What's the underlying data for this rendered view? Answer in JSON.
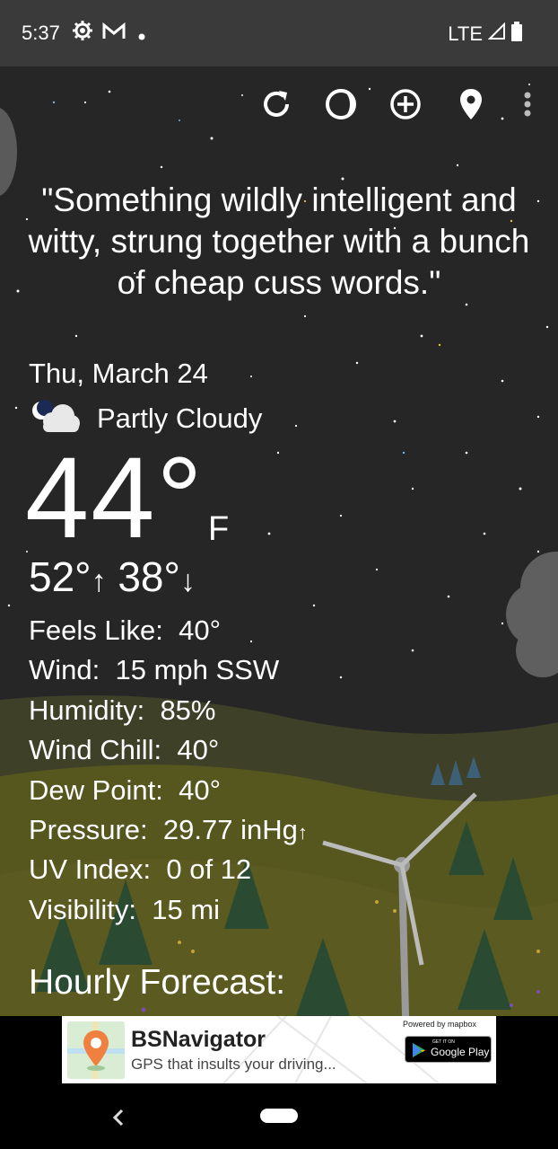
{
  "status": {
    "time": "5:37",
    "network": "LTE",
    "icons": [
      "settings-gear-icon",
      "gmail-icon",
      "notification-dot-icon",
      "signal-icon",
      "battery-icon"
    ]
  },
  "toolbar": {
    "icons": [
      "refresh-icon",
      "theme-icon",
      "add-location-icon",
      "location-pin-icon",
      "more-vert-icon"
    ]
  },
  "quote": "\"Something wildly intelligent and witty, strung together with a bunch of cheap cuss words.\"",
  "weather": {
    "date": "Thu, March 24",
    "condition": "Partly Cloudy",
    "condition_icon": "partly-cloudy-night-icon",
    "temperature": "44°",
    "unit": "F",
    "high": "52°",
    "low": "38°",
    "high_arrow": "↑",
    "low_arrow": "↓"
  },
  "details": [
    {
      "label": "Feels Like:",
      "value": "40°"
    },
    {
      "label": "Wind:",
      "value": "15 mph SSW"
    },
    {
      "label": "Humidity:",
      "value": "85%"
    },
    {
      "label": "Wind Chill:",
      "value": "40°"
    },
    {
      "label": "Dew Point:",
      "value": "40°"
    },
    {
      "label": "Pressure:",
      "value": "29.77 inHg",
      "trend": "↑"
    },
    {
      "label": "UV Index:",
      "value": "0 of 12"
    },
    {
      "label": "Visibility:",
      "value": "15 mi"
    }
  ],
  "hourly_title": "Hourly Forecast:",
  "ad": {
    "title": "BSNavigator",
    "subtitle": "GPS that insults your driving...",
    "powered_by": "Powered by mapbox",
    "play_small": "GET IT ON",
    "play_label": "Google Play"
  },
  "colors": {
    "status_bar": "#3a3a3a",
    "sky": "#262626",
    "hill": "#6b6b2e"
  }
}
